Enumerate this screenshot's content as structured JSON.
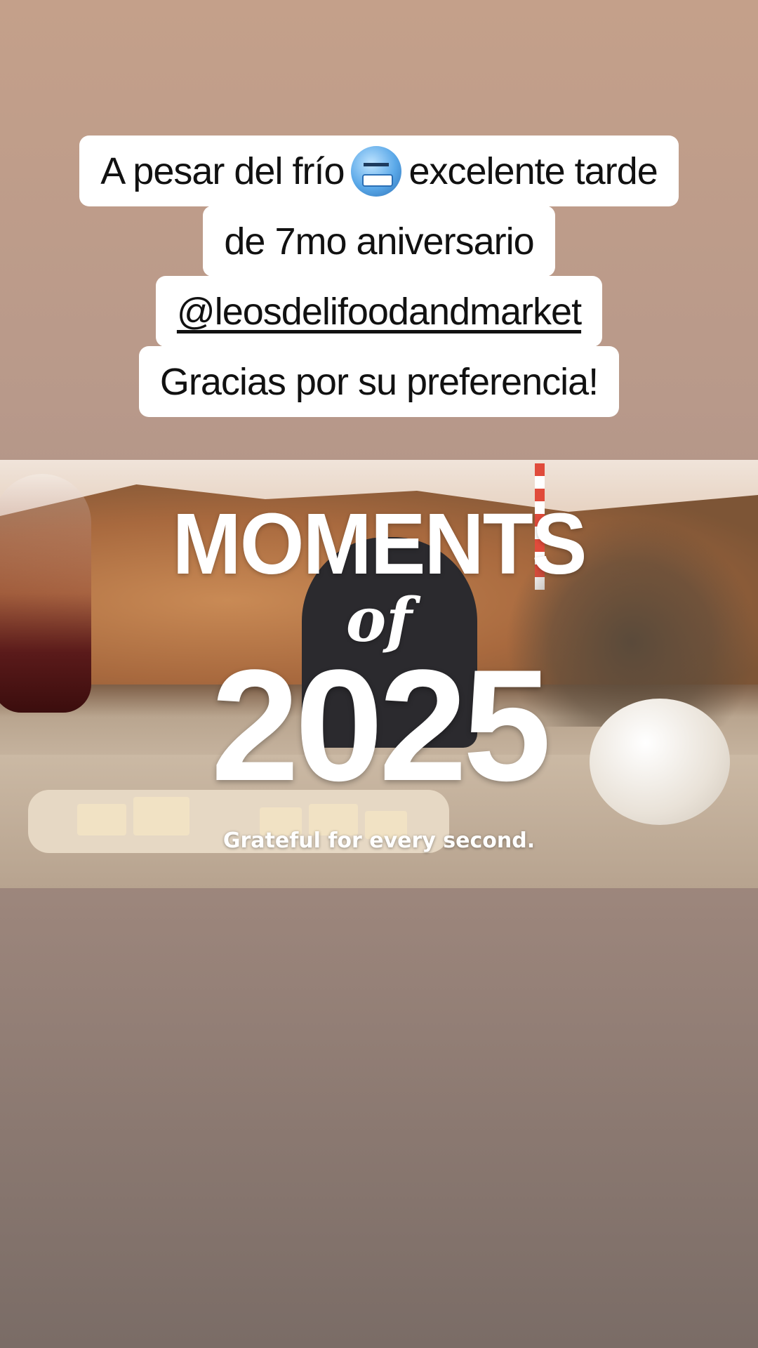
{
  "caption": {
    "line1_before": "A pesar del frío",
    "line1_emoji": "cold-face-emoji",
    "line1_after": "excelente tarde",
    "line2": "de 7mo aniversario",
    "line3": "@leosdelifoodandmarket",
    "line4": "Gracias por su preferencia!"
  },
  "media": {
    "title_top": "MOMENTS",
    "title_mid": "of",
    "title_year": "2025",
    "subtitle": "Grateful for every second."
  }
}
